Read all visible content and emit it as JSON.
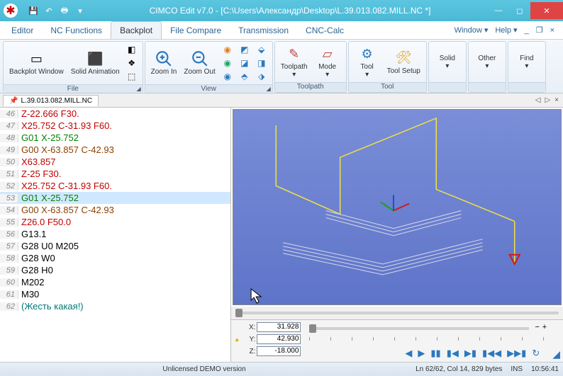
{
  "titlebar": {
    "app_title": "CIMCO Edit v7.0 - [C:\\Users\\Александр\\Desktop\\L.39.013.082.MILL.NC *]"
  },
  "menu": {
    "tabs": [
      "Editor",
      "NC Functions",
      "Backplot",
      "File Compare",
      "Transmission",
      "CNC-Calc"
    ],
    "active_index": 2,
    "window_label": "Window",
    "help_label": "Help"
  },
  "ribbon": {
    "groups": {
      "file": {
        "label": "File",
        "backplot_window": "Backplot\nWindow",
        "solid_animation": "Solid\nAnimation"
      },
      "view": {
        "label": "View",
        "zoom_in": "Zoom\nIn",
        "zoom_out": "Zoom\nOut"
      },
      "toolpath": {
        "label": "Toolpath",
        "toolpath": "Toolpath",
        "mode": "Mode"
      },
      "tool": {
        "label": "Tool",
        "tool": "Tool",
        "tool_setup": "Tool\nSetup"
      },
      "solid": {
        "label": "Solid"
      },
      "other": {
        "label": "Other"
      },
      "find": {
        "label": "Find"
      }
    }
  },
  "doc_tab": {
    "name": "L.39.013.082.MILL.NC"
  },
  "code_lines": [
    {
      "n": 46,
      "segs": [
        {
          "t": "Z-22.666 F30.",
          "c": "c-red"
        }
      ]
    },
    {
      "n": 47,
      "segs": [
        {
          "t": "X25.752 C-31.93 F60.",
          "c": "c-red"
        }
      ]
    },
    {
      "n": 48,
      "segs": [
        {
          "t": "G01 X-25.752",
          "c": "c-green"
        }
      ]
    },
    {
      "n": 49,
      "segs": [
        {
          "t": "G00 X-63.857 C-42.93",
          "c": "c-brown"
        }
      ]
    },
    {
      "n": 50,
      "segs": [
        {
          "t": "X63.857",
          "c": "c-red"
        }
      ]
    },
    {
      "n": 51,
      "segs": [
        {
          "t": "Z-25 F30.",
          "c": "c-red"
        }
      ]
    },
    {
      "n": 52,
      "segs": [
        {
          "t": "X25.752 C-31.93 F60.",
          "c": "c-red"
        }
      ]
    },
    {
      "n": 53,
      "segs": [
        {
          "t": "G01 X-25.752",
          "c": "c-green"
        }
      ],
      "hl": true
    },
    {
      "n": 54,
      "segs": [
        {
          "t": "G00 X-63.857 C-42.93",
          "c": "c-brown"
        }
      ]
    },
    {
      "n": 55,
      "segs": [
        {
          "t": "Z26.0 F50.0",
          "c": "c-red"
        }
      ]
    },
    {
      "n": 56,
      "segs": [
        {
          "t": "G13.1",
          "c": "c-black"
        }
      ]
    },
    {
      "n": 57,
      "segs": [
        {
          "t": "G28 U0 M205",
          "c": "c-black"
        }
      ]
    },
    {
      "n": 58,
      "segs": [
        {
          "t": "G28 W0",
          "c": "c-black"
        }
      ]
    },
    {
      "n": 59,
      "segs": [
        {
          "t": "G28 H0",
          "c": "c-black"
        }
      ]
    },
    {
      "n": 60,
      "segs": [
        {
          "t": "M202",
          "c": "c-black"
        }
      ]
    },
    {
      "n": 61,
      "segs": [
        {
          "t": "M30",
          "c": "c-black"
        }
      ]
    },
    {
      "n": 62,
      "segs": [
        {
          "t": "(Жесть какая!)",
          "c": "c-teal"
        }
      ]
    }
  ],
  "coords": {
    "x_label": "X:",
    "x_value": "31.928",
    "y_label": "Y:",
    "y_value": "42.930",
    "z_label": "Z:",
    "z_value": "-18.000"
  },
  "status": {
    "demo": "Unlicensed DEMO version",
    "pos": "Ln 62/62, Col 14, 829 bytes",
    "ins": "INS",
    "time": "10:56:41"
  }
}
